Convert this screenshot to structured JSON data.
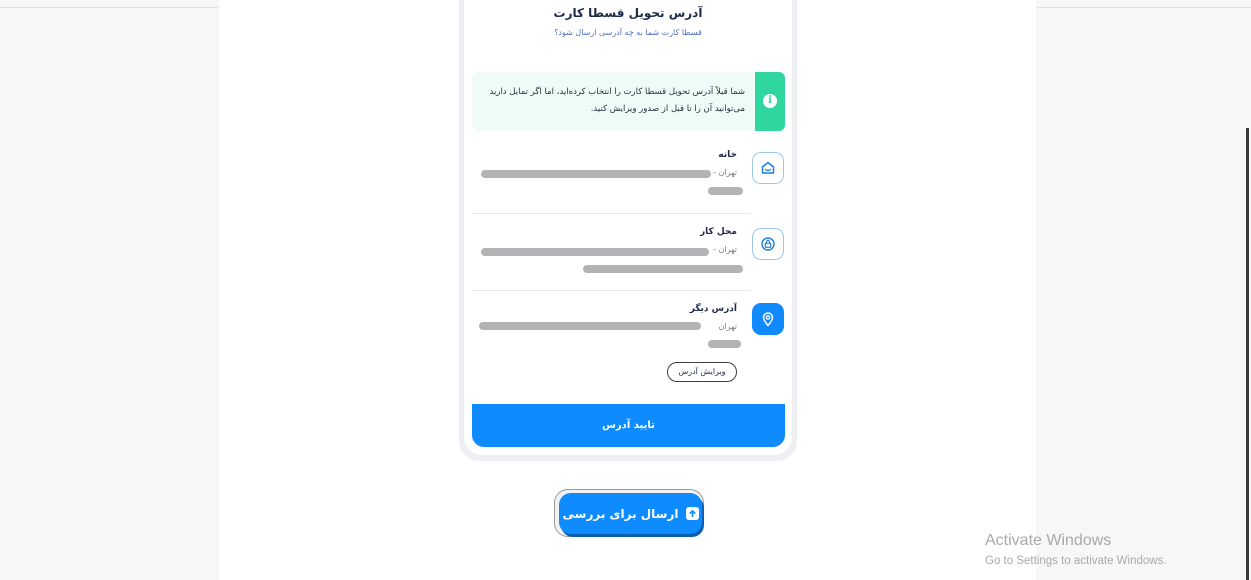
{
  "modal": {
    "title": "آدرس تحویل قسطا کارت",
    "subtitle": "قسطا کارت شما به چه آدرسی ارسال شود؟",
    "notice": "شما قبلاً آدرس تحویل قسطا کارت را انتخاب کرده‌اید، اما اگر تمایل دارید می‌توانید آن را تا قبل از صدور ویرایش کنید.",
    "addresses": [
      {
        "title": "خانه",
        "city": "تهران -",
        "icon": "home-icon",
        "selected": false
      },
      {
        "title": "محل کار",
        "city": "تهران -",
        "icon": "work-lock-icon",
        "selected": false
      },
      {
        "title": "آدرس دیگر",
        "city": "تهران",
        "icon": "location-pin-icon",
        "selected": true
      }
    ],
    "edit_label": "ویرایش آدرس",
    "confirm_label": "تایید آدرس"
  },
  "send_button_label": "ارسال برای بررسی",
  "watermark": {
    "title": "Activate Windows",
    "subtitle": "Go to Settings to activate Windows."
  },
  "colors": {
    "primary": "#0d8bff",
    "notice_accent": "#2fd6a0",
    "notice_bg": "#eefbf6"
  }
}
